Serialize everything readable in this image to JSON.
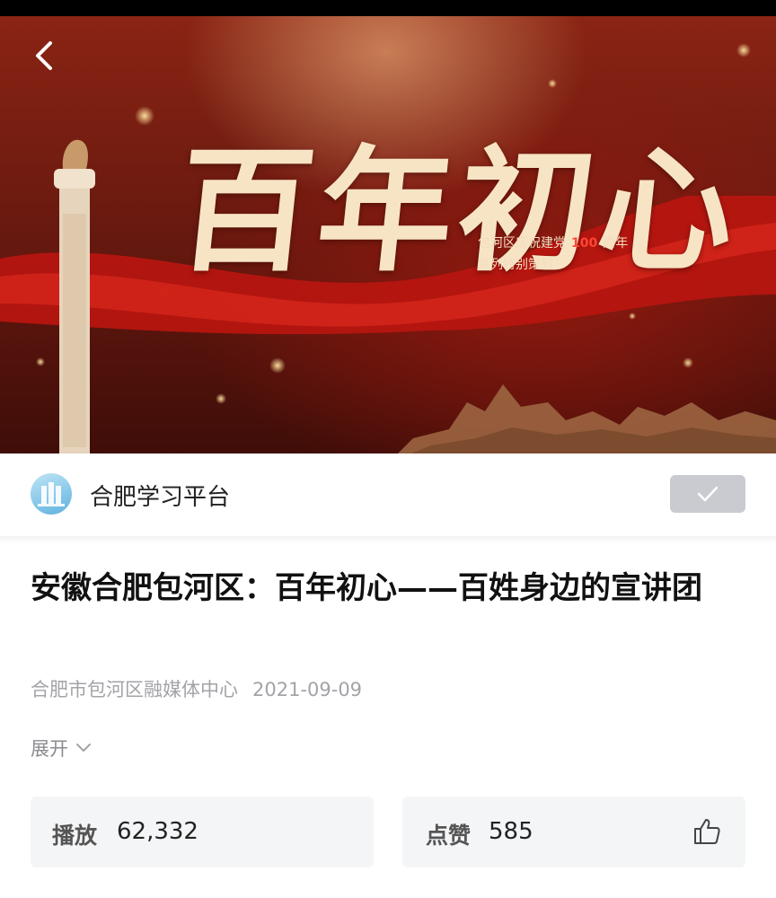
{
  "video": {
    "poster_title": "百年初心",
    "poster_subtitle_prefix": "包河区庆祝建党",
    "poster_subtitle_number": "100",
    "poster_subtitle_suffix": "周年",
    "poster_subtitle_line2": "系列特别策划",
    "progress_fraction": 0.01
  },
  "channel": {
    "name": "合肥学习平台",
    "follow_icon": "checkmark-icon"
  },
  "article": {
    "title": "安徽合肥包河区：百年初心——百姓身边的宣讲团",
    "source": "合肥市包河区融媒体中心",
    "date": "2021-09-09",
    "expand_label": "展开"
  },
  "stats": {
    "plays_label": "播放",
    "plays_value": "62,332",
    "likes_label": "点赞",
    "likes_value": "585",
    "like_icon": "thumbs-up-icon"
  },
  "colors": {
    "accent": "#ff4636",
    "follow_bg": "#c9cbd1",
    "card_bg": "#f4f5f7"
  }
}
